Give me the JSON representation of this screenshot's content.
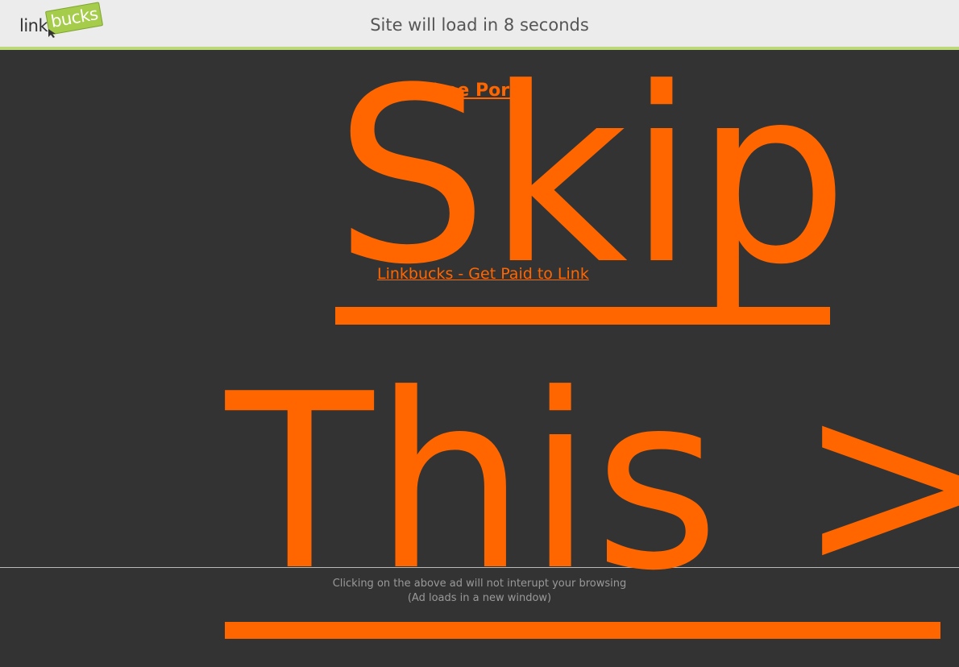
{
  "header": {
    "logo": {
      "part1": "link",
      "part2": "bucks"
    },
    "countdown_text": "Site will load in 8 seconds"
  },
  "ads": {
    "link1": "Free Porn",
    "link2": "Linkbucks - Get Paid to Link"
  },
  "skip_button": {
    "line1": "Skip",
    "line2": "This >"
  },
  "footer": {
    "notice_line1": "Clicking on the above ad will not interupt your browsing",
    "notice_line2": "(Ad loads in a new window)"
  },
  "colors": {
    "background": "#333333",
    "accent": "#ff6600",
    "header_bg": "#ececec",
    "header_border": "#bcd97a",
    "logo_green": "#a5cc4a"
  }
}
